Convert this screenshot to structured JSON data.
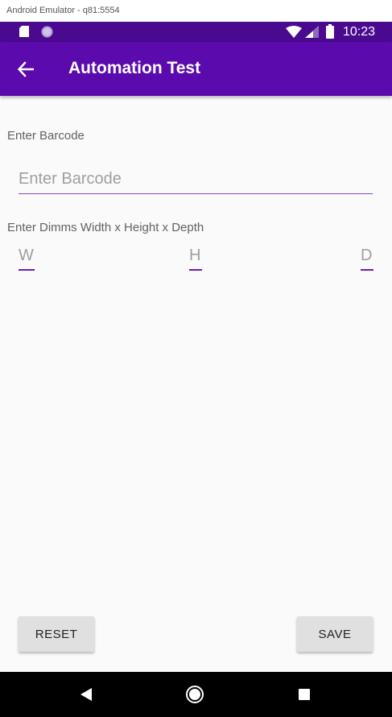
{
  "window": {
    "title": "Android Emulator - q81:5554"
  },
  "status_bar": {
    "time": "10:23",
    "icons": [
      "sd-card-icon",
      "notification-dot-icon",
      "wifi-icon",
      "cell-signal-icon",
      "battery-icon"
    ],
    "background_color": "#4a0a8f"
  },
  "app_bar": {
    "title": "Automation Test",
    "back_icon": "arrow-back-icon",
    "background_color": "#5b0aad"
  },
  "form": {
    "barcode_label": "Enter Barcode",
    "barcode_placeholder": "Enter Barcode",
    "barcode_value": "",
    "dimms_label": "Enter Dimms Width x Height x Depth",
    "width_placeholder": "W",
    "height_placeholder": "H",
    "depth_placeholder": "D",
    "accent_color": "#6a1bbd"
  },
  "buttons": {
    "reset_label": "RESET",
    "save_label": "SAVE"
  },
  "nav_bar": {
    "icons": [
      "nav-back-icon",
      "nav-home-icon",
      "nav-recents-icon"
    ]
  }
}
